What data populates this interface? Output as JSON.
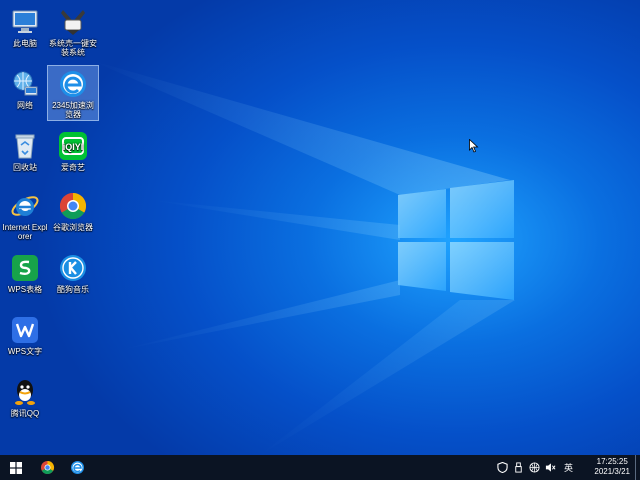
{
  "desktop": {
    "icons": [
      {
        "label": "此电脑",
        "icon": "computer-icon"
      },
      {
        "label": "系统売一键安装系统",
        "icon": "installer-icon"
      },
      {
        "label": "网络",
        "icon": "network-icon"
      },
      {
        "label": "2345加速浏览器",
        "icon": "browser-2345-icon"
      },
      {
        "label": "回收站",
        "icon": "recycle-bin-icon"
      },
      {
        "label": "爱奇艺",
        "icon": "iqiyi-icon"
      },
      {
        "label": "Internet Explorer",
        "icon": "ie-icon"
      },
      {
        "label": "谷歌浏览器",
        "icon": "chrome-icon"
      },
      {
        "label": "WPS表格",
        "icon": "wps-sheet-icon"
      },
      {
        "label": "酷狗音乐",
        "icon": "kugou-icon"
      },
      {
        "label": "WPS文字",
        "icon": "wps-writer-icon"
      },
      {
        "label": "腾讯QQ",
        "icon": "qq-icon"
      }
    ]
  },
  "taskbar": {
    "pinned": [
      "start-icon",
      "chrome-icon",
      "browser-2345-icon"
    ],
    "ime": "英",
    "time": "17:25:25",
    "date": "2021/3/21"
  },
  "colors": {
    "taskbar": "#0b1423",
    "desktop_accent": "#1fa3ff"
  }
}
